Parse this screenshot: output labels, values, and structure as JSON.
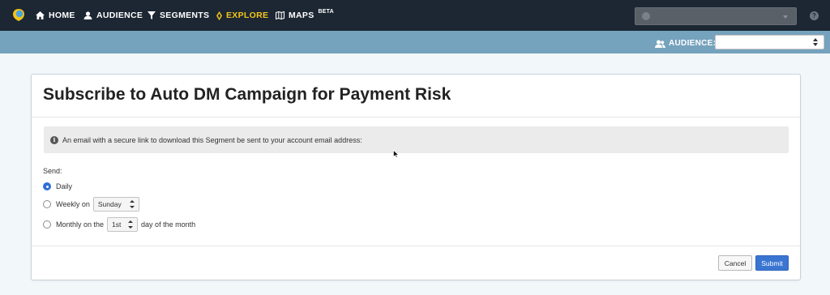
{
  "nav": {
    "items": [
      {
        "label": "HOME",
        "icon": "home-icon"
      },
      {
        "label": "AUDIENCE",
        "icon": "user-icon"
      },
      {
        "label": "SEGMENTS",
        "icon": "filter-icon"
      },
      {
        "label": "EXPLORE",
        "icon": "compass-icon",
        "active": true
      },
      {
        "label": "MAPS",
        "icon": "map-icon",
        "badge": "BETA"
      }
    ],
    "help_icon": "?"
  },
  "audience_bar": {
    "label": "AUDIENCE:",
    "value": ""
  },
  "dialog": {
    "title": "Subscribe to Auto DM Campaign for Payment Risk",
    "info_icon": "i",
    "info_text": "An email with a secure link to download this Segment be sent to your account email address:",
    "send_label": "Send:",
    "options": {
      "daily": "Daily",
      "weekly_prefix": "Weekly on",
      "weekly_day": "Sunday",
      "monthly_prefix": "Monthly on the",
      "monthly_day": "1st",
      "monthly_suffix": "day of the month"
    },
    "selected": "Daily",
    "cancel_label": "Cancel",
    "submit_label": "Submit"
  },
  "colors": {
    "top_nav": "#1c2733",
    "audience_bar": "#75a2bd",
    "active_nav": "#f5c518",
    "primary": "#3a75d1"
  }
}
